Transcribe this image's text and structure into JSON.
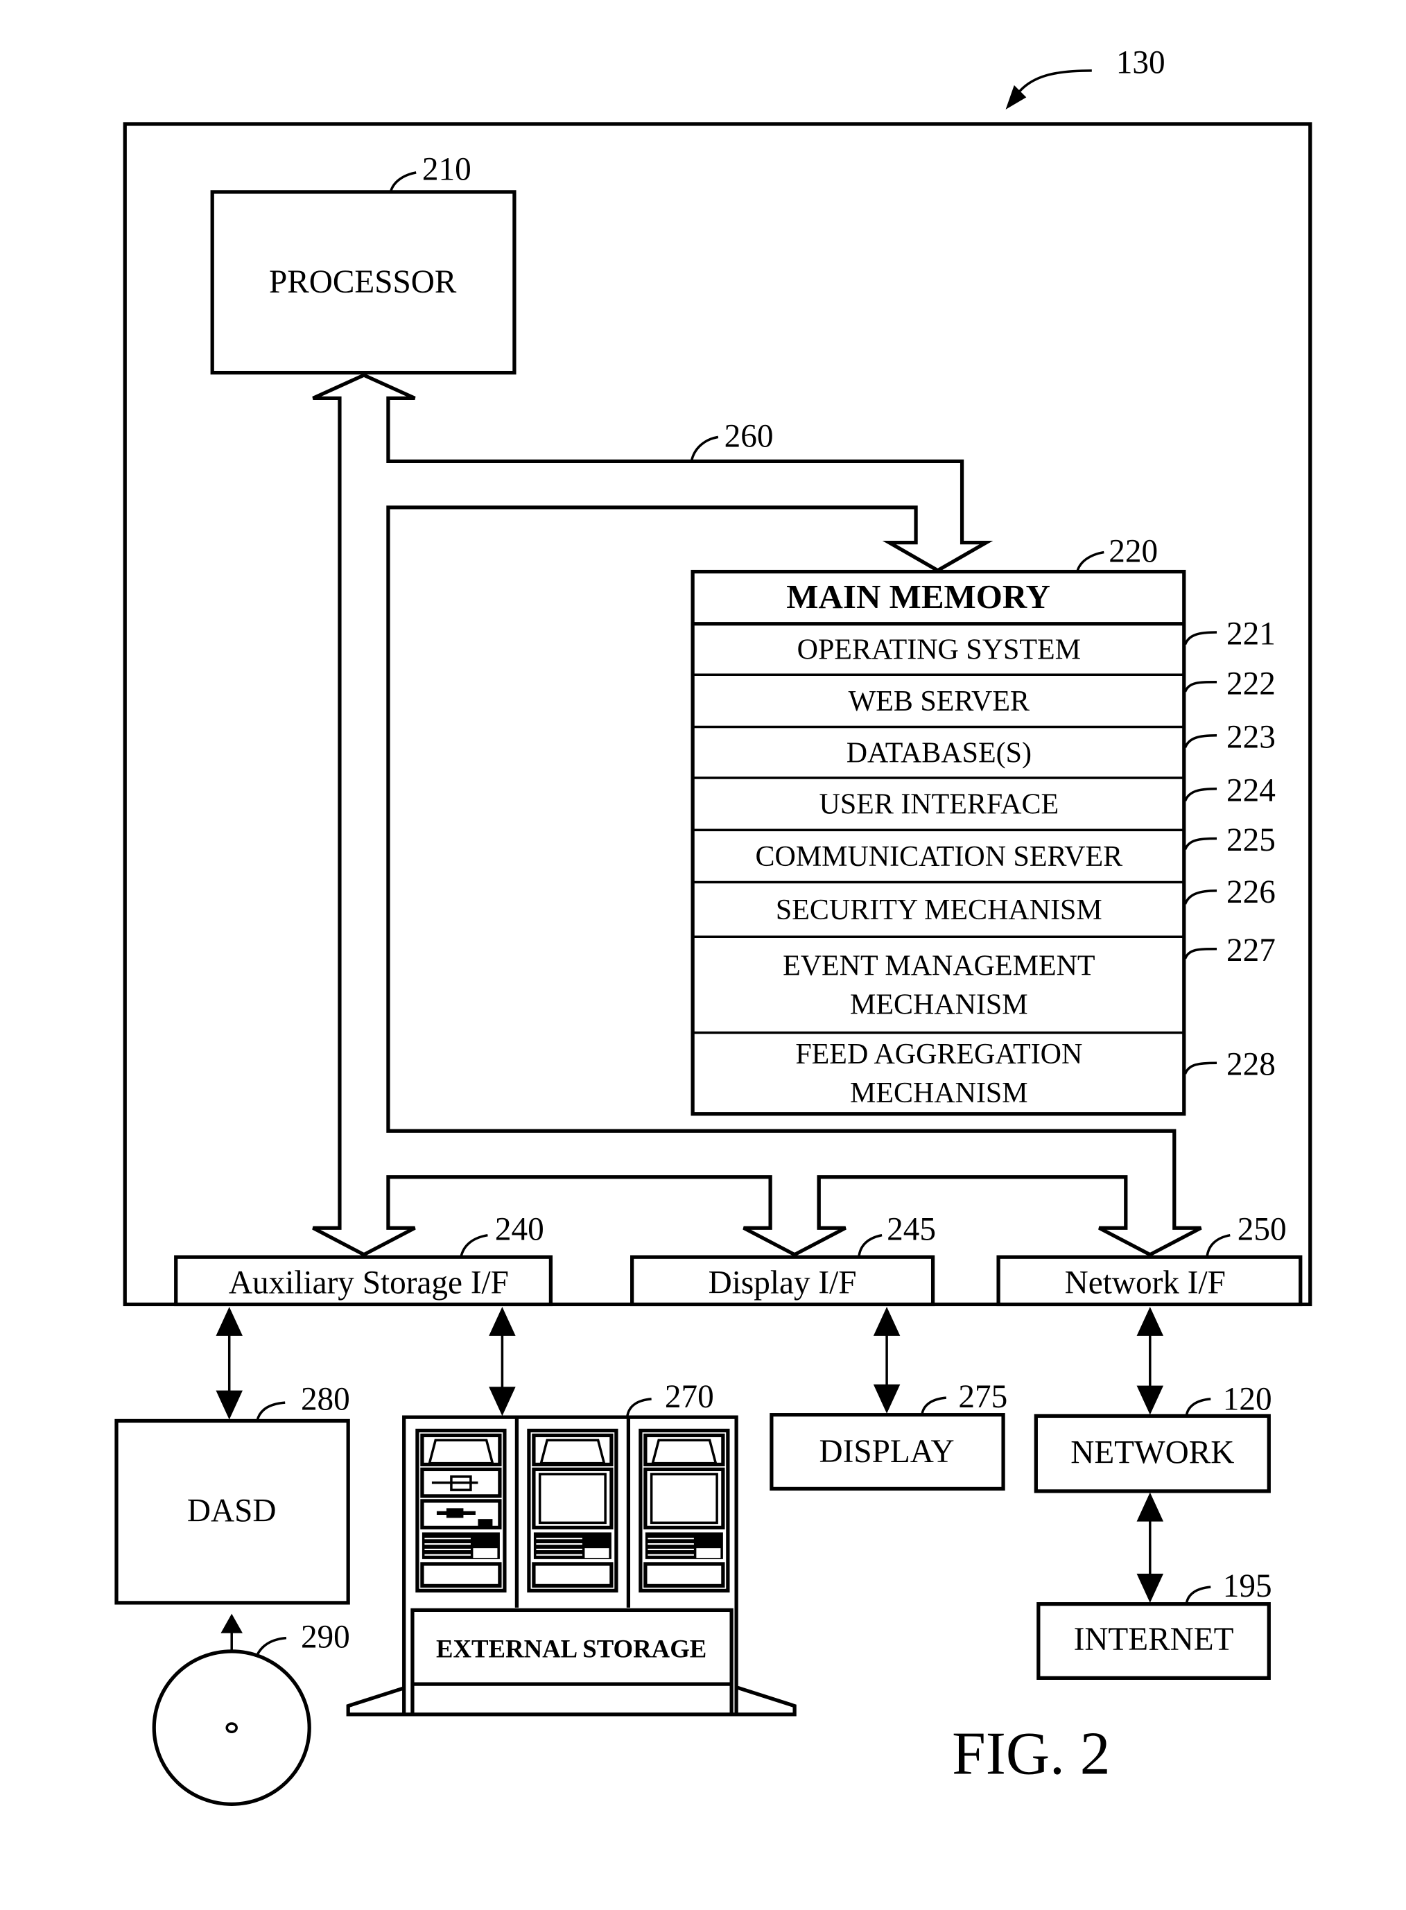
{
  "figure": {
    "caption": "FIG. 2",
    "system_ref": "130"
  },
  "processor": {
    "label": "PROCESSOR",
    "ref": "210"
  },
  "bus": {
    "ref": "260"
  },
  "main_memory": {
    "title": "MAIN MEMORY",
    "ref": "220",
    "rows": [
      {
        "lines": [
          "OPERATING SYSTEM"
        ],
        "ref": "221"
      },
      {
        "lines": [
          "WEB SERVER"
        ],
        "ref": "222"
      },
      {
        "lines": [
          "DATABASE(S)"
        ],
        "ref": "223"
      },
      {
        "lines": [
          "USER INTERFACE"
        ],
        "ref": "224"
      },
      {
        "lines": [
          "COMMUNICATION SERVER"
        ],
        "ref": "225"
      },
      {
        "lines": [
          "SECURITY MECHANISM"
        ],
        "ref": "226"
      },
      {
        "lines": [
          "EVENT MANAGEMENT",
          "MECHANISM"
        ],
        "ref": "227"
      },
      {
        "lines": [
          "FEED AGGREGATION",
          "MECHANISM"
        ],
        "ref": "228"
      }
    ]
  },
  "interfaces": {
    "aux_storage": {
      "label": "Auxiliary Storage I/F",
      "ref": "240"
    },
    "display": {
      "label": "Display I/F",
      "ref": "245"
    },
    "network": {
      "label": "Network I/F",
      "ref": "250"
    }
  },
  "devices": {
    "dasd": {
      "label": "DASD",
      "ref": "280"
    },
    "disk": {
      "ref": "290"
    },
    "external_storage": {
      "label": "EXTERNAL STORAGE",
      "ref": "270"
    },
    "display": {
      "label": "DISPLAY",
      "ref": "275"
    },
    "network": {
      "label": "NETWORK",
      "ref": "120"
    },
    "internet": {
      "label": "INTERNET",
      "ref": "195"
    }
  }
}
